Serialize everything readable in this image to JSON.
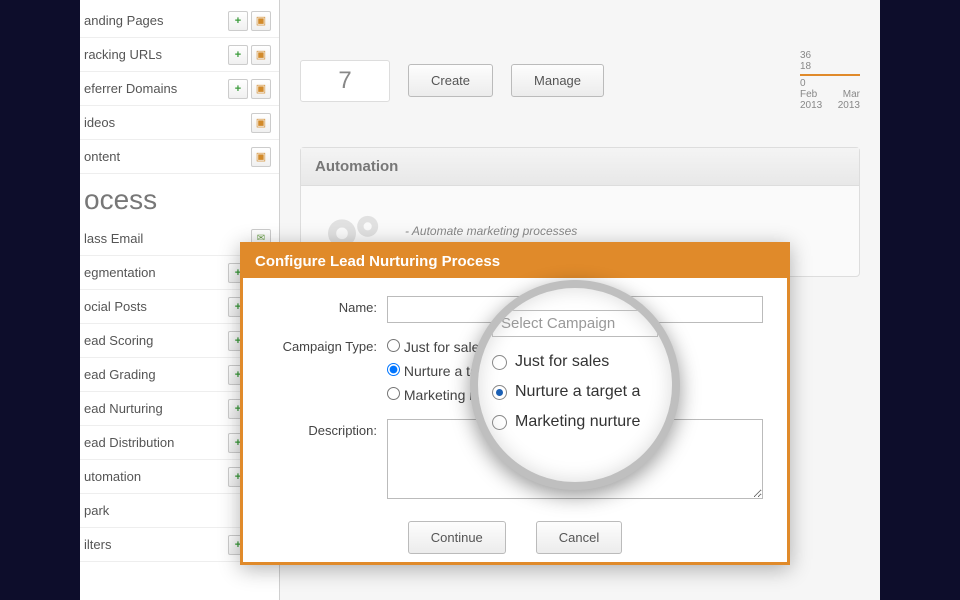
{
  "sidebar": {
    "items1": [
      {
        "label": "anding Pages",
        "add": true,
        "folder": true
      },
      {
        "label": "racking URLs",
        "add": true,
        "folder": true
      },
      {
        "label": "eferrer Domains",
        "add": true,
        "folder": true
      },
      {
        "label": "ideos",
        "add": false,
        "folder": true
      },
      {
        "label": "ontent",
        "add": false,
        "folder": true
      }
    ],
    "section": "ocess",
    "items2": [
      {
        "label": "lass Email",
        "mail": true
      },
      {
        "label": "egmentation",
        "add": true,
        "folder": true
      },
      {
        "label": "ocial Posts",
        "add": true,
        "folder": true
      },
      {
        "label": "ead Scoring",
        "add": true,
        "folder": true
      },
      {
        "label": "ead Grading",
        "add": true,
        "folder": true
      },
      {
        "label": "ead Nurturing",
        "add": true,
        "folder": true
      },
      {
        "label": "ead Distribution",
        "add": true,
        "folder": true
      },
      {
        "label": "utomation",
        "add": true,
        "folder": true
      },
      {
        "label": "park",
        "add": false,
        "folder": true
      },
      {
        "label": "ilters",
        "add": true,
        "folder": true
      }
    ]
  },
  "top": {
    "count": "7",
    "create": "Create",
    "manage": "Manage",
    "y1": "36",
    "y2": "18",
    "y3": "0",
    "x1": "Feb",
    "x2": "Mar",
    "yr": "2013"
  },
  "panel": {
    "title": "Automation",
    "desc": "- Automate marketing processes"
  },
  "modal": {
    "title": "Configure Lead Nurturing Process",
    "name_label": "Name:",
    "campaign_label": "Campaign Type:",
    "desc_label": "Description:",
    "continue": "Continue",
    "cancel": "Cancel"
  },
  "mag": {
    "select": "Select Campaign",
    "opt1": "Just for sales",
    "opt2": "Nurture a target a",
    "opt3": "Marketing nurture"
  }
}
